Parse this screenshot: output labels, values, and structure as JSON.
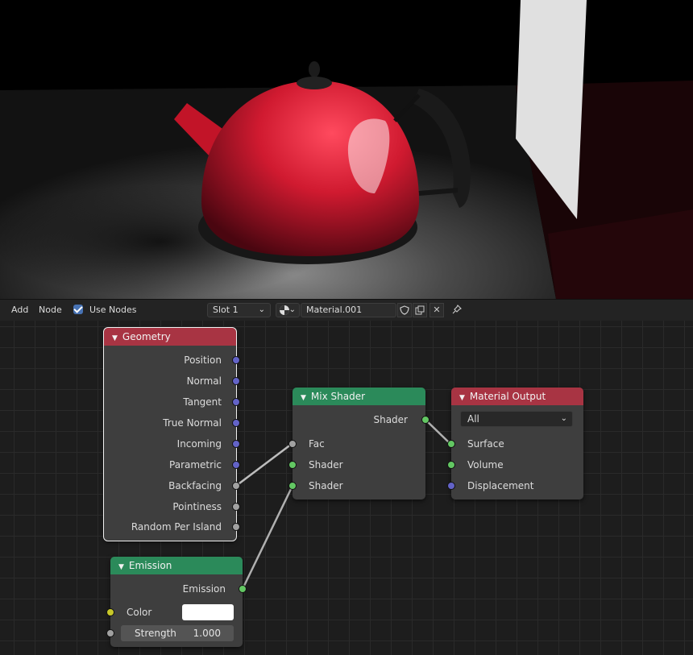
{
  "header": {
    "add_label": "Add",
    "node_label": "Node",
    "use_nodes_label": "Use Nodes",
    "use_nodes_checked": true,
    "slot_value": "Slot 1",
    "material_name": "Material.001",
    "icons": [
      "material-sphere-icon",
      "fake-user-shield-icon",
      "duplicate-icon",
      "unlink-x-icon",
      "pin-icon"
    ]
  },
  "nodes": {
    "geometry": {
      "title": "Geometry",
      "header_color": "#a83443",
      "outputs": [
        "Position",
        "Normal",
        "Tangent",
        "True Normal",
        "Incoming",
        "Parametric",
        "Backfacing",
        "Pointiness",
        "Random Per Island"
      ]
    },
    "mix_shader": {
      "title": "Mix Shader",
      "header_color": "#2b8a5a",
      "output": "Shader",
      "inputs": [
        "Fac",
        "Shader",
        "Shader"
      ]
    },
    "material_output": {
      "title": "Material Output",
      "header_color": "#a83443",
      "target": "All",
      "inputs": [
        "Surface",
        "Volume",
        "Displacement"
      ]
    },
    "emission": {
      "title": "Emission",
      "header_color": "#2b8a5a",
      "output": "Emission",
      "color_label": "Color",
      "color_value": "#ffffff",
      "strength_label": "Strength",
      "strength_value": "1.000"
    }
  },
  "colors": {
    "socket_vector": "#6363c7",
    "socket_float": "#a1a1a1",
    "socket_shader": "#63c763",
    "socket_color": "#c7c729",
    "accent": "#4772b3"
  }
}
